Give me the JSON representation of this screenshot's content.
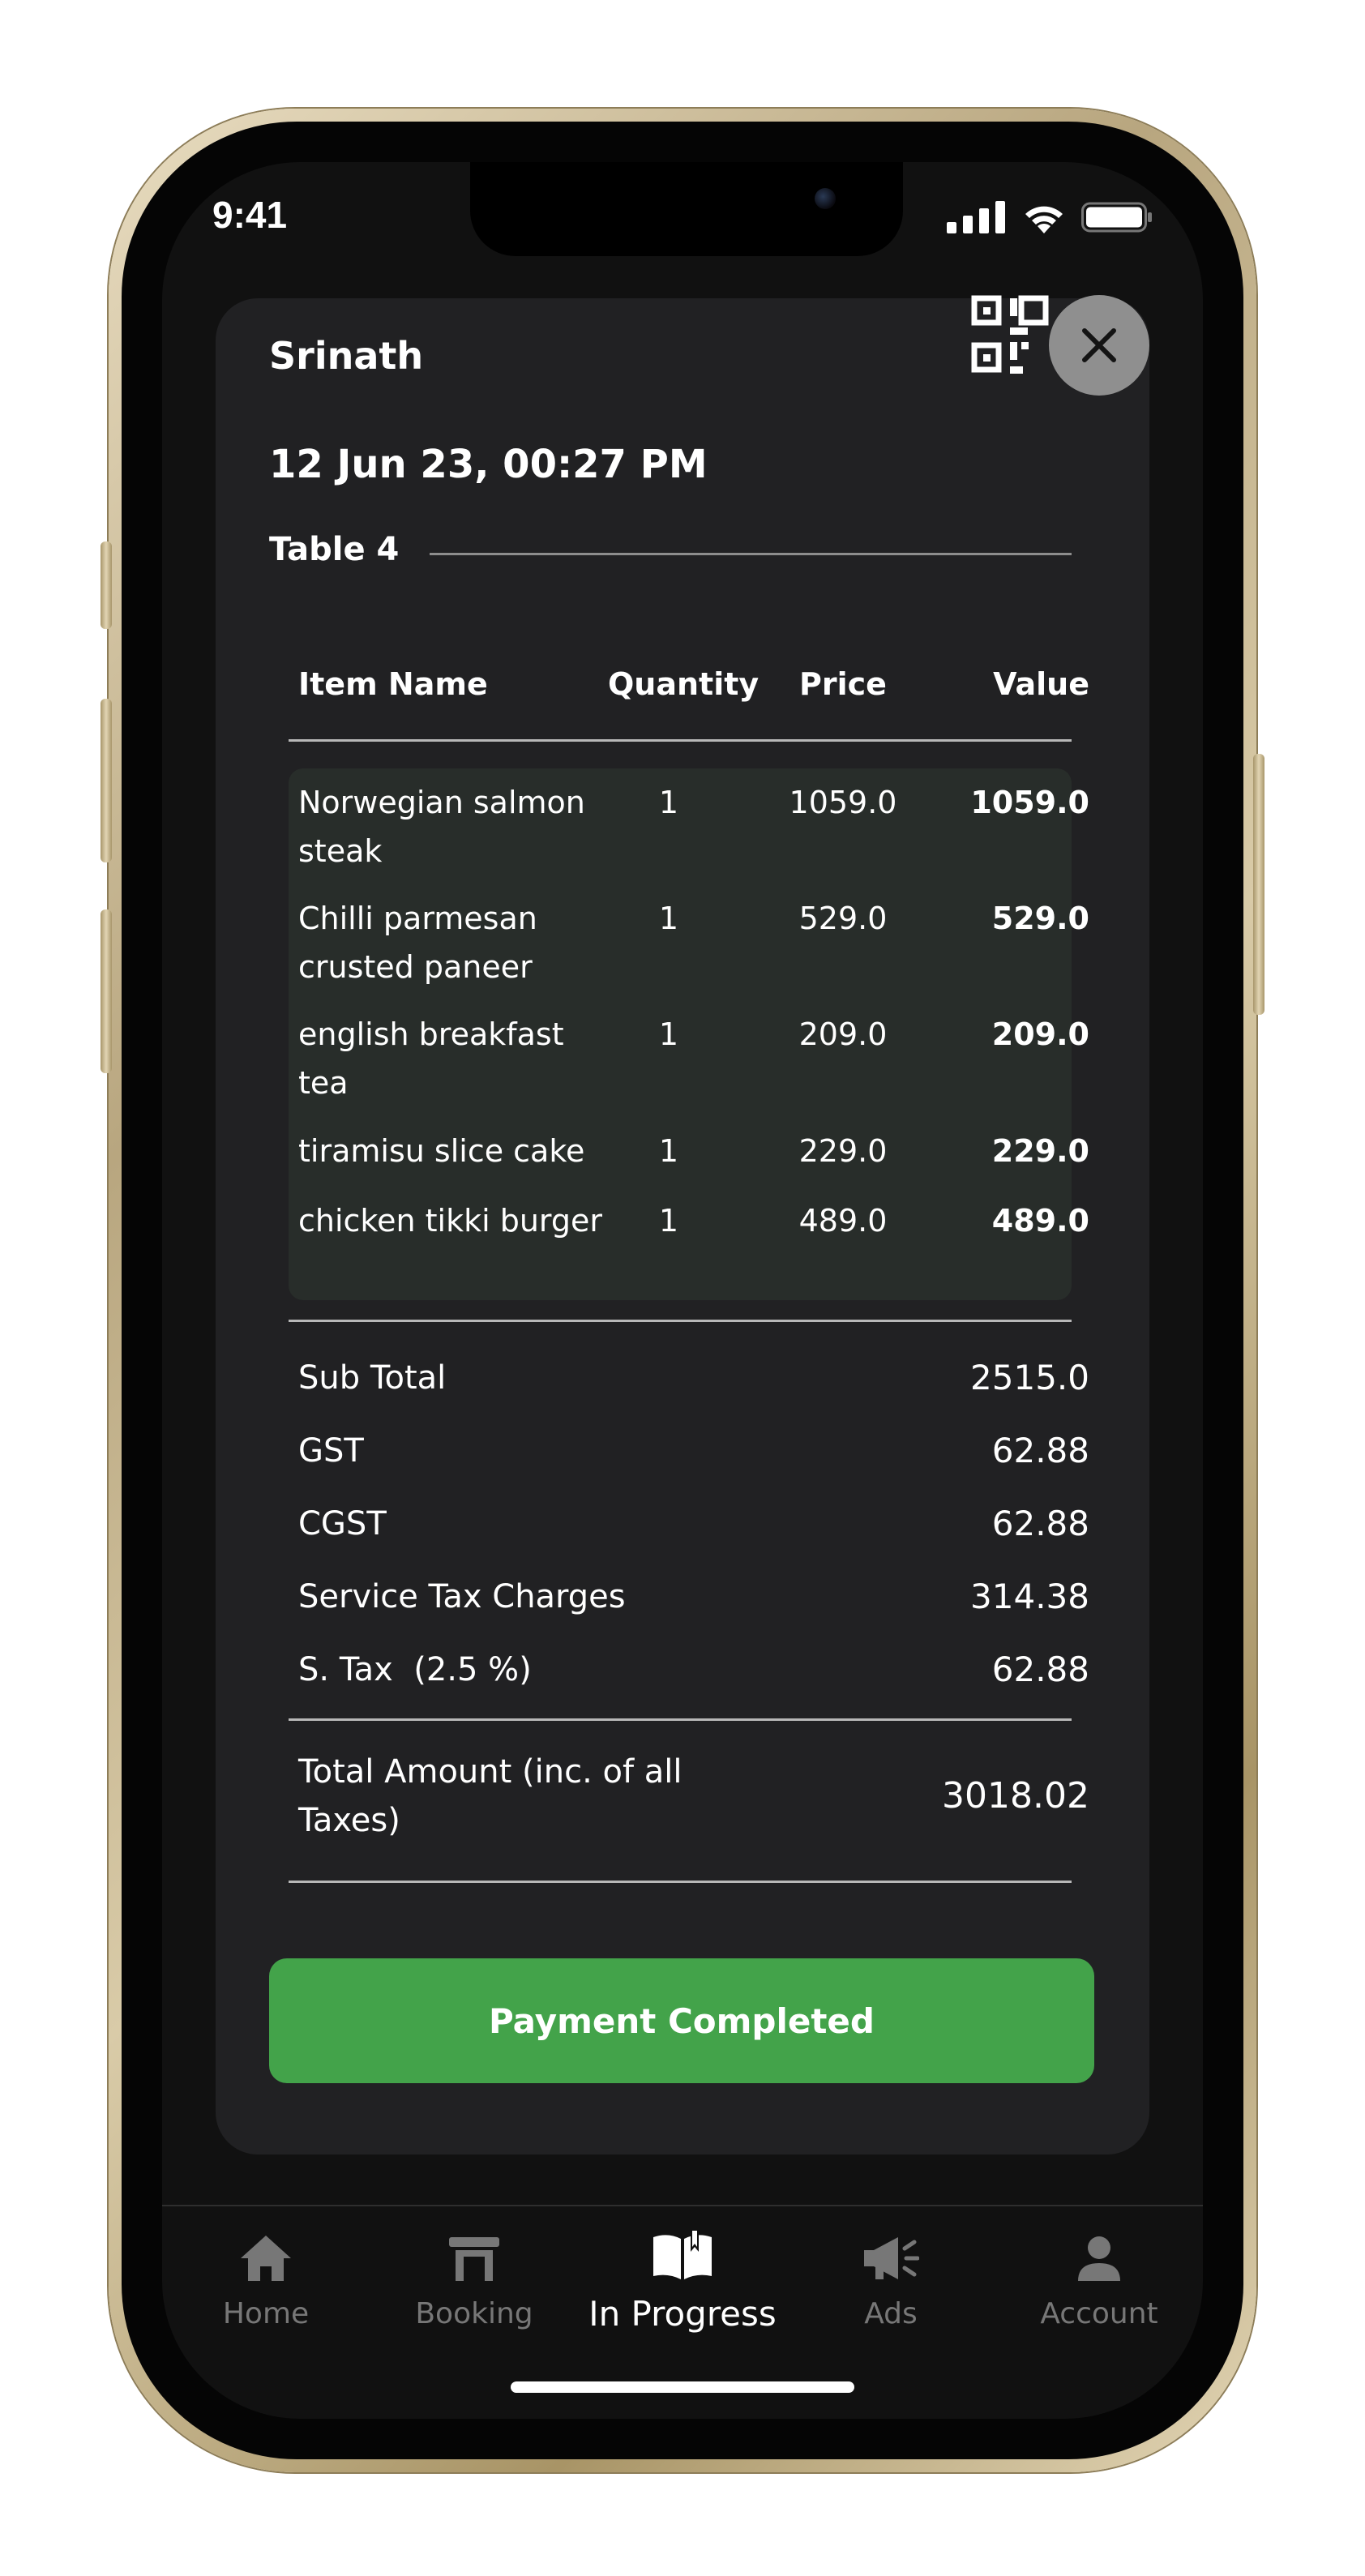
{
  "status_bar": {
    "time": "9:41"
  },
  "bill": {
    "customer_name": "Srinath",
    "date_time": "12 Jun 23, 00:27 PM",
    "table": "Table 4",
    "headers": {
      "item_name": "Item Name",
      "quantity": "Quantity",
      "price": "Price",
      "value": "Value"
    },
    "items": [
      {
        "name": "Norwegian salmon steak",
        "quantity": "1",
        "price": "1059.0",
        "value": "1059.0"
      },
      {
        "name": "Chilli parmesan crusted paneer",
        "quantity": "1",
        "price": "529.0",
        "value": "529.0"
      },
      {
        "name": "english breakfast tea",
        "quantity": "1",
        "price": "209.0",
        "value": "209.0"
      },
      {
        "name": "tiramisu slice cake",
        "quantity": "1",
        "price": "229.0",
        "value": "229.0"
      },
      {
        "name": "chicken tikki burger",
        "quantity": "1",
        "price": "489.0",
        "value": "489.0"
      }
    ],
    "summary": [
      {
        "label": "Sub Total",
        "value": "2515.0"
      },
      {
        "label": "GST",
        "value": "62.88"
      },
      {
        "label": "CGST",
        "value": "62.88"
      },
      {
        "label": "Service Tax Charges",
        "value": "314.38"
      },
      {
        "label": "S. Tax  (2.5 %)",
        "value": "62.88"
      }
    ],
    "total": {
      "label": "Total Amount (inc. of all Taxes)",
      "value": "3018.02"
    },
    "payment_button": "Payment Completed"
  },
  "icons": {
    "close": "close-icon",
    "qr": "qr-code-icon"
  },
  "nav": {
    "items": [
      {
        "label": "Home",
        "icon": "home-icon",
        "active": false
      },
      {
        "label": "Booking",
        "icon": "table-icon",
        "active": false
      },
      {
        "label": "In Progress",
        "icon": "book-icon",
        "active": true
      },
      {
        "label": "Ads",
        "icon": "megaphone-icon",
        "active": false
      },
      {
        "label": "Account",
        "icon": "person-icon",
        "active": false
      }
    ]
  },
  "colors": {
    "accent": "#43a34a",
    "card": "#212123",
    "items_bg": "#282d2a",
    "inactive_nav": "#777777"
  }
}
